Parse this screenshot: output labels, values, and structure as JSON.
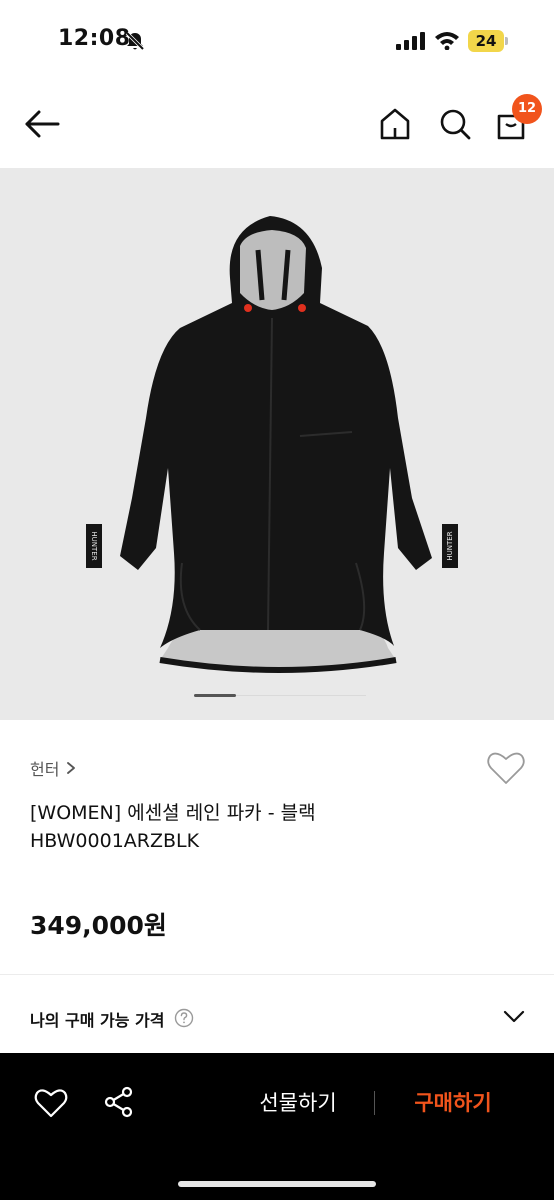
{
  "status_bar": {
    "time": "12:08",
    "battery": "24"
  },
  "header": {
    "cart_count": "12"
  },
  "product": {
    "brand": "헌터",
    "name": "[WOMEN] 에센셜 레인 파카 - 블랙",
    "code": "HBW0001ARZBLK",
    "price": "349,000원",
    "image_logo_text": "HUNTER"
  },
  "my_price": {
    "label": "나의 구매 가능 가격"
  },
  "bottom_bar": {
    "gift_label": "선물하기",
    "buy_label": "구매하기"
  },
  "colors": {
    "accent": "#f1541c",
    "image_background": "#e9e9e9",
    "bottom_bar": "#000000"
  },
  "icons": [
    "bell-slash-icon",
    "signal-icon",
    "wifi-icon",
    "battery-icon",
    "back-arrow-icon",
    "home-icon",
    "search-icon",
    "shopping-bag-icon",
    "chevron-right-icon",
    "heart-icon",
    "help-circle-icon",
    "chevron-down-icon",
    "share-icon"
  ]
}
